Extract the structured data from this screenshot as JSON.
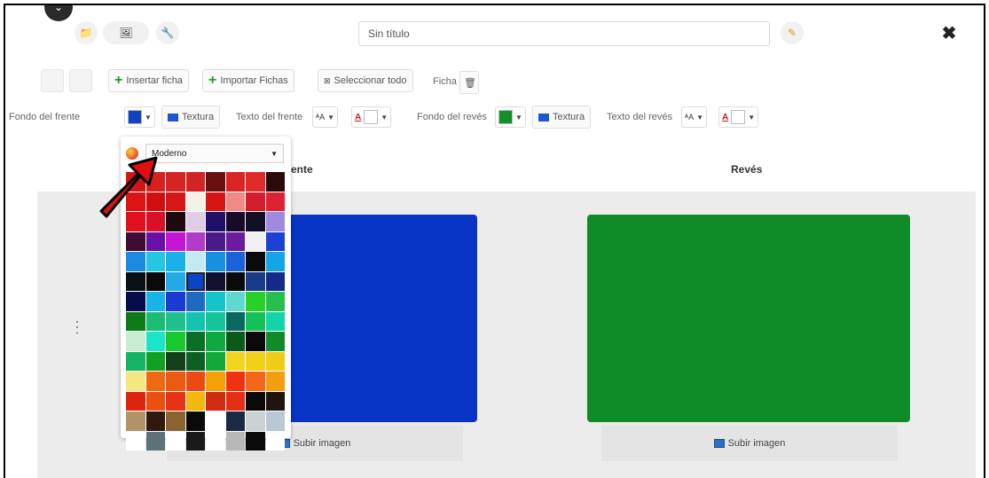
{
  "app": {
    "title_value": "Sin título",
    "close_label": "✖"
  },
  "toolbar": {
    "insert_label": "Insertar ficha",
    "import_label": "Importar Fichas",
    "select_all_label": "Seleccionar todo",
    "card_label": "Ficha"
  },
  "styles": {
    "front_bg_label": "Fondo del frente",
    "front_bg_color": "#1142c4",
    "texture_label": "Textura",
    "front_text_label": "Texto del frente",
    "back_bg_label": "Fondo del revés",
    "back_bg_color": "#109026",
    "back_text_label": "Texto del revés",
    "font_icon_label": "ᴬA",
    "text_color_label": "A"
  },
  "content": {
    "front_header": "Frente",
    "back_header": "Revés",
    "upload_label": "Subir imagen",
    "front_card_color": "#0734c4",
    "back_card_color": "#0f8c28"
  },
  "picker": {
    "palette_name": "Moderno",
    "colors": [
      "#d21616",
      "#d82020",
      "#d42424",
      "#d22424",
      "#6a0f0f",
      "#d82424",
      "#e02a2a",
      "#2a0a0a",
      "#dc1414",
      "#d01010",
      "#d41818",
      "#f4f1e6",
      "#d61414",
      "#f08a8a",
      "#d41c2c",
      "#dc2233",
      "#e01020",
      "#d8102a",
      "#200810",
      "#e0cbe8",
      "#20106a",
      "#1a0a2a",
      "#121024",
      "#a08ae0",
      "#400c34",
      "#6810a8",
      "#c414d4",
      "#b43ac8",
      "#4a1a8a",
      "#6a1c9c",
      "#f0f0f0",
      "#1a40d4",
      "#1c8ae0",
      "#24c6e0",
      "#1ab0e8",
      "#c4eaf4",
      "#1890e0",
      "#1a62d8",
      "#0a0a0a",
      "#16a4e8",
      "#0a1018",
      "#0a0a0a",
      "#22aae8",
      "#0d43c6",
      "#101030",
      "#0a0a0a",
      "#1a3a8a",
      "#142a88",
      "#080c4a",
      "#18b4e8",
      "#1a3ad4",
      "#1e6ac0",
      "#14c4c8",
      "#60d8d0",
      "#28d028",
      "#26c050",
      "#0c7a18",
      "#1cbc74",
      "#20c08c",
      "#12c4b0",
      "#16c49c",
      "#0a6860",
      "#14c058",
      "#12d4a8",
      "#c8ecd0",
      "#1ce4c8",
      "#18c830",
      "#087028",
      "#10a840",
      "#0a5a1a",
      "#0a0a0a",
      "#118a2a",
      "#14b464",
      "#10a024",
      "#14401c",
      "#0c6024",
      "#14a838",
      "#f0d420",
      "#f2d018",
      "#f0cc16",
      "#f4e680",
      "#ee6a10",
      "#ea5a10",
      "#ec4a10",
      "#f4a008",
      "#f03210",
      "#f26818",
      "#f29e10",
      "#dc2410",
      "#ea5010",
      "#e83218",
      "#f0b810",
      "#d02c14",
      "#e43012",
      "#0a0a0a",
      "#201410",
      "#b09468",
      "#301a10",
      "#8a6430",
      "#0a0a0a",
      "#ffffff",
      "#1a2a44",
      "#cad2d4",
      "#b8c8d4",
      "#ffffff",
      "#5a7278",
      "#ffffff",
      "#1a1a1a",
      "#ffffff",
      "#b8b8b8",
      "#0a0a0a",
      "#ffffff"
    ],
    "selected_index": 43
  }
}
